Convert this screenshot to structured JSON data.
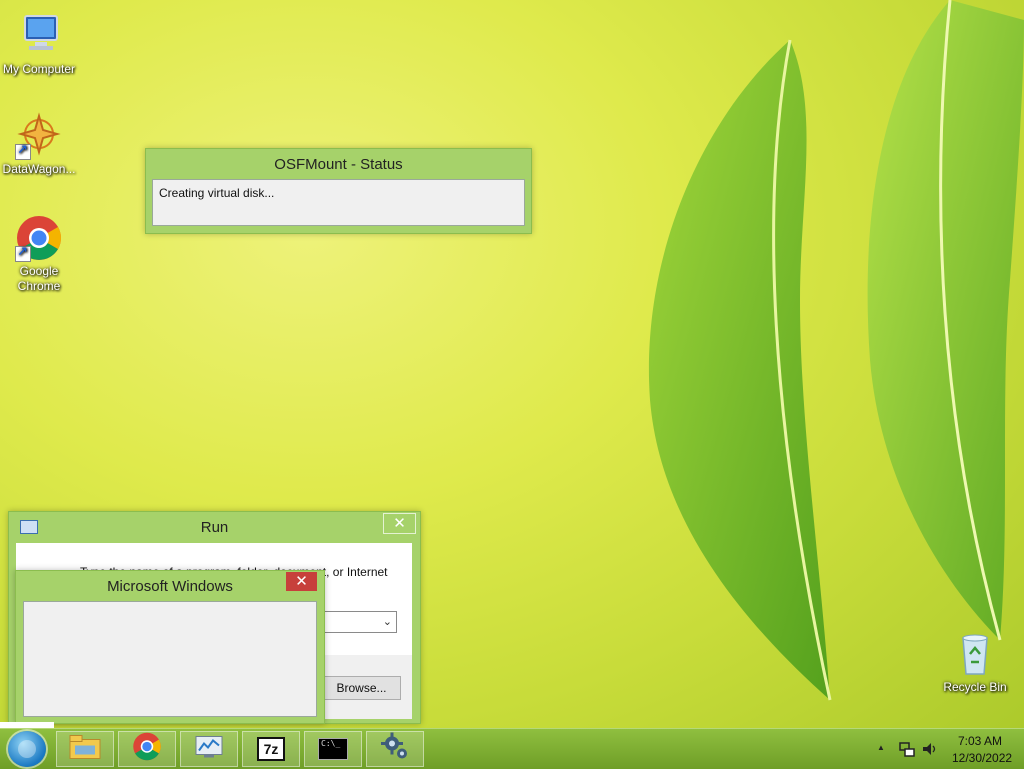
{
  "desktop": {
    "icons": [
      {
        "label": "My Computer"
      },
      {
        "label": "DataWagon..."
      },
      {
        "label": "Google Chrome"
      },
      {
        "label": "Recycle Bin"
      }
    ]
  },
  "osfmount_window": {
    "title": "OSFMount - Status",
    "message": "Creating virtual disk..."
  },
  "run_dialog": {
    "title": "Run",
    "instruction_visible": "Type the name of a program, folder, document, or Internet",
    "open_value": "",
    "browse_label": "Browse...",
    "close_glyph": "✕"
  },
  "ms_windows_window": {
    "title": "Microsoft Windows",
    "close_glyph": "✕"
  },
  "taskbar": {
    "pinned": [
      {
        "name": "file-explorer"
      },
      {
        "name": "google-chrome"
      },
      {
        "name": "performance-monitor"
      },
      {
        "name": "7-zip",
        "text": "7z"
      },
      {
        "name": "command-prompt",
        "text": "C:\\_"
      },
      {
        "name": "settings"
      }
    ],
    "tray": {
      "time": "7:03 AM",
      "date": "12/30/2022",
      "show_hidden_glyph": "▲"
    }
  },
  "colors": {
    "window_frame": "#a6d26a",
    "close_button": "#c7403b",
    "taskbar": "#7fae32"
  }
}
